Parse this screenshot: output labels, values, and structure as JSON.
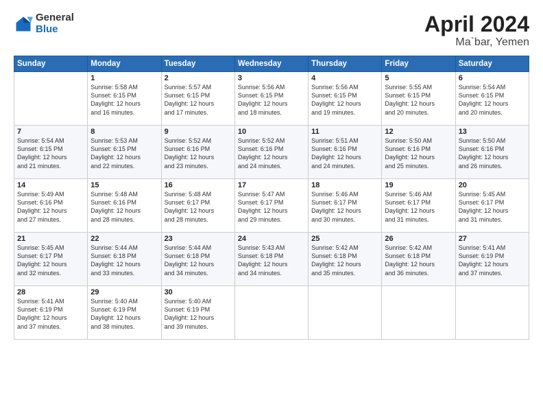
{
  "logo": {
    "general": "General",
    "blue": "Blue"
  },
  "title": "April 2024",
  "location": "Ma`bar, Yemen",
  "header_days": [
    "Sunday",
    "Monday",
    "Tuesday",
    "Wednesday",
    "Thursday",
    "Friday",
    "Saturday"
  ],
  "weeks": [
    [
      {
        "day": "",
        "info": ""
      },
      {
        "day": "1",
        "info": "Sunrise: 5:58 AM\nSunset: 6:15 PM\nDaylight: 12 hours\nand 16 minutes."
      },
      {
        "day": "2",
        "info": "Sunrise: 5:57 AM\nSunset: 6:15 PM\nDaylight: 12 hours\nand 17 minutes."
      },
      {
        "day": "3",
        "info": "Sunrise: 5:56 AM\nSunset: 6:15 PM\nDaylight: 12 hours\nand 18 minutes."
      },
      {
        "day": "4",
        "info": "Sunrise: 5:56 AM\nSunset: 6:15 PM\nDaylight: 12 hours\nand 19 minutes."
      },
      {
        "day": "5",
        "info": "Sunrise: 5:55 AM\nSunset: 6:15 PM\nDaylight: 12 hours\nand 20 minutes."
      },
      {
        "day": "6",
        "info": "Sunrise: 5:54 AM\nSunset: 6:15 PM\nDaylight: 12 hours\nand 20 minutes."
      }
    ],
    [
      {
        "day": "7",
        "info": "Sunrise: 5:54 AM\nSunset: 6:15 PM\nDaylight: 12 hours\nand 21 minutes."
      },
      {
        "day": "8",
        "info": "Sunrise: 5:53 AM\nSunset: 6:15 PM\nDaylight: 12 hours\nand 22 minutes."
      },
      {
        "day": "9",
        "info": "Sunrise: 5:52 AM\nSunset: 6:16 PM\nDaylight: 12 hours\nand 23 minutes."
      },
      {
        "day": "10",
        "info": "Sunrise: 5:52 AM\nSunset: 6:16 PM\nDaylight: 12 hours\nand 24 minutes."
      },
      {
        "day": "11",
        "info": "Sunrise: 5:51 AM\nSunset: 6:16 PM\nDaylight: 12 hours\nand 24 minutes."
      },
      {
        "day": "12",
        "info": "Sunrise: 5:50 AM\nSunset: 6:16 PM\nDaylight: 12 hours\nand 25 minutes."
      },
      {
        "day": "13",
        "info": "Sunrise: 5:50 AM\nSunset: 6:16 PM\nDaylight: 12 hours\nand 26 minutes."
      }
    ],
    [
      {
        "day": "14",
        "info": "Sunrise: 5:49 AM\nSunset: 6:16 PM\nDaylight: 12 hours\nand 27 minutes."
      },
      {
        "day": "15",
        "info": "Sunrise: 5:48 AM\nSunset: 6:16 PM\nDaylight: 12 hours\nand 28 minutes."
      },
      {
        "day": "16",
        "info": "Sunrise: 5:48 AM\nSunset: 6:17 PM\nDaylight: 12 hours\nand 28 minutes."
      },
      {
        "day": "17",
        "info": "Sunrise: 5:47 AM\nSunset: 6:17 PM\nDaylight: 12 hours\nand 29 minutes."
      },
      {
        "day": "18",
        "info": "Sunrise: 5:46 AM\nSunset: 6:17 PM\nDaylight: 12 hours\nand 30 minutes."
      },
      {
        "day": "19",
        "info": "Sunrise: 5:46 AM\nSunset: 6:17 PM\nDaylight: 12 hours\nand 31 minutes."
      },
      {
        "day": "20",
        "info": "Sunrise: 5:45 AM\nSunset: 6:17 PM\nDaylight: 12 hours\nand 31 minutes."
      }
    ],
    [
      {
        "day": "21",
        "info": "Sunrise: 5:45 AM\nSunset: 6:17 PM\nDaylight: 12 hours\nand 32 minutes."
      },
      {
        "day": "22",
        "info": "Sunrise: 5:44 AM\nSunset: 6:18 PM\nDaylight: 12 hours\nand 33 minutes."
      },
      {
        "day": "23",
        "info": "Sunrise: 5:44 AM\nSunset: 6:18 PM\nDaylight: 12 hours\nand 34 minutes."
      },
      {
        "day": "24",
        "info": "Sunrise: 5:43 AM\nSunset: 6:18 PM\nDaylight: 12 hours\nand 34 minutes."
      },
      {
        "day": "25",
        "info": "Sunrise: 5:42 AM\nSunset: 6:18 PM\nDaylight: 12 hours\nand 35 minutes."
      },
      {
        "day": "26",
        "info": "Sunrise: 5:42 AM\nSunset: 6:18 PM\nDaylight: 12 hours\nand 36 minutes."
      },
      {
        "day": "27",
        "info": "Sunrise: 5:41 AM\nSunset: 6:19 PM\nDaylight: 12 hours\nand 37 minutes."
      }
    ],
    [
      {
        "day": "28",
        "info": "Sunrise: 5:41 AM\nSunset: 6:19 PM\nDaylight: 12 hours\nand 37 minutes."
      },
      {
        "day": "29",
        "info": "Sunrise: 5:40 AM\nSunset: 6:19 PM\nDaylight: 12 hours\nand 38 minutes."
      },
      {
        "day": "30",
        "info": "Sunrise: 5:40 AM\nSunset: 6:19 PM\nDaylight: 12 hours\nand 39 minutes."
      },
      {
        "day": "",
        "info": ""
      },
      {
        "day": "",
        "info": ""
      },
      {
        "day": "",
        "info": ""
      },
      {
        "day": "",
        "info": ""
      }
    ]
  ]
}
